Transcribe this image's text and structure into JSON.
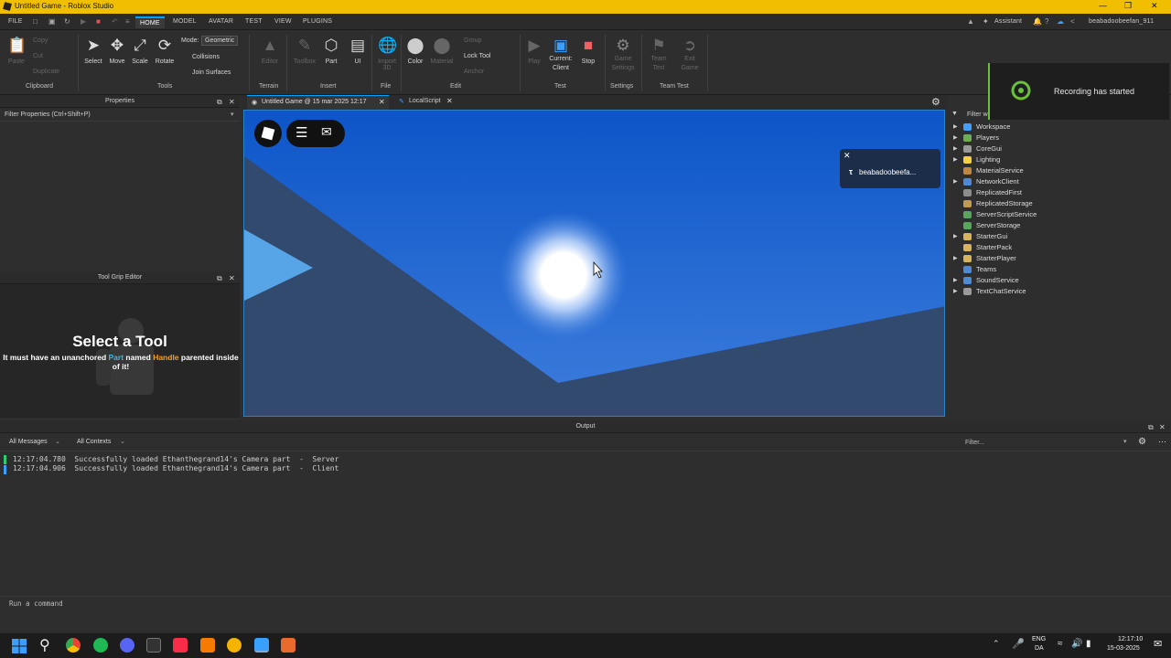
{
  "window": {
    "title": "Untitled Game - Roblox Studio"
  },
  "menu": {
    "file": "FILE",
    "tabs": [
      "HOME",
      "MODEL",
      "AVATAR",
      "TEST",
      "VIEW",
      "PLUGINS"
    ],
    "active_tab": "HOME",
    "assistant": "Assistant",
    "username": "beabadoobeefan_911"
  },
  "ribbon": {
    "clipboard": {
      "paste": "Paste",
      "copy": "Copy",
      "cut": "Cut",
      "duplicate": "Duplicate",
      "group": "Clipboard"
    },
    "tools": {
      "select": "Select",
      "move": "Move",
      "scale": "Scale",
      "rotate": "Rotate",
      "mode_label": "Mode:",
      "mode_value": "Geometric",
      "collisions": "Collisions",
      "join_surfaces": "Join Surfaces",
      "group": "Tools"
    },
    "terrain": {
      "editor": "Editor",
      "group": "Terrain"
    },
    "insert": {
      "toolbox": "Toolbox",
      "part": "Part",
      "ui": "UI",
      "group": "Insert"
    },
    "file": {
      "import_3d": "Import 3D",
      "group": "File"
    },
    "edit": {
      "color": "Color",
      "material": "Material",
      "group_btn": "Group",
      "lock_tool": "Lock Tool",
      "anchor": "Anchor",
      "group": "Edit"
    },
    "test": {
      "play": "Play",
      "current_client": "Current: Client",
      "stop": "Stop",
      "group": "Test"
    },
    "settings": {
      "game_settings": "Game Settings",
      "group": "Settings"
    },
    "team_test": {
      "team_test": "Team Test",
      "exit_game": "Exit Game",
      "group": "Team Test"
    }
  },
  "properties": {
    "title": "Properties",
    "filter": "Filter Properties (Ctrl+Shift+P)"
  },
  "tool_grip": {
    "title": "Tool Grip Editor",
    "heading": "Select a Tool",
    "text_1": "It must have an unanchored ",
    "part": "Part",
    "text_2": " named ",
    "handle": "Handle",
    "text_3": " parented inside of it!"
  },
  "doc_tabs": [
    {
      "label": "Untitled Game @ 15 mar 2025 12:17"
    },
    {
      "label": "LocalScript"
    }
  ],
  "game": {
    "player_tag": "beabadoobeefa..."
  },
  "explorer": {
    "filter": "Filter workspace (Ctrl+Shift+X)",
    "items": [
      {
        "label": "Workspace",
        "arrow": true,
        "color": "#3fa0ff"
      },
      {
        "label": "Players",
        "arrow": true,
        "color": "#6ab04c"
      },
      {
        "label": "CoreGui",
        "arrow": true,
        "color": "#9a9a9a"
      },
      {
        "label": "Lighting",
        "arrow": true,
        "color": "#f5d142"
      },
      {
        "label": "MaterialService",
        "arrow": false,
        "color": "#c0883d"
      },
      {
        "label": "NetworkClient",
        "arrow": true,
        "color": "#4b8bd6"
      },
      {
        "label": "ReplicatedFirst",
        "arrow": false,
        "color": "#8c8c8c"
      },
      {
        "label": "ReplicatedStorage",
        "arrow": false,
        "color": "#c29c4e"
      },
      {
        "label": "ServerScriptService",
        "arrow": false,
        "color": "#58a55c"
      },
      {
        "label": "ServerStorage",
        "arrow": false,
        "color": "#58a55c"
      },
      {
        "label": "StarterGui",
        "arrow": true,
        "color": "#d8b35a"
      },
      {
        "label": "StarterPack",
        "arrow": false,
        "color": "#d8b35a"
      },
      {
        "label": "StarterPlayer",
        "arrow": true,
        "color": "#d8b35a"
      },
      {
        "label": "Teams",
        "arrow": false,
        "color": "#4b8bd6"
      },
      {
        "label": "SoundService",
        "arrow": true,
        "color": "#4b8bd6"
      },
      {
        "label": "TextChatService",
        "arrow": true,
        "color": "#9a9a9a"
      }
    ]
  },
  "recording": {
    "text": "Recording has started"
  },
  "output": {
    "title": "Output",
    "filter_messages": "All Messages",
    "filter_contexts": "All Contexts",
    "filter_placeholder": "Filter...",
    "lines": [
      {
        "text": "12:17:04.780  Successfully loaded Ethanthegrand14's Camera part  -  Server",
        "color": "#2ecc71"
      },
      {
        "text": "12:17:04.906  Successfully loaded Ethanthegrand14's Camera part  -  Client",
        "color": "#3aa0ff"
      }
    ],
    "command_placeholder": "Run a command"
  },
  "taskbar": {
    "lang_1": "ENG",
    "lang_2": "DA",
    "time": "12:17:10",
    "date": "15-03-2025"
  }
}
